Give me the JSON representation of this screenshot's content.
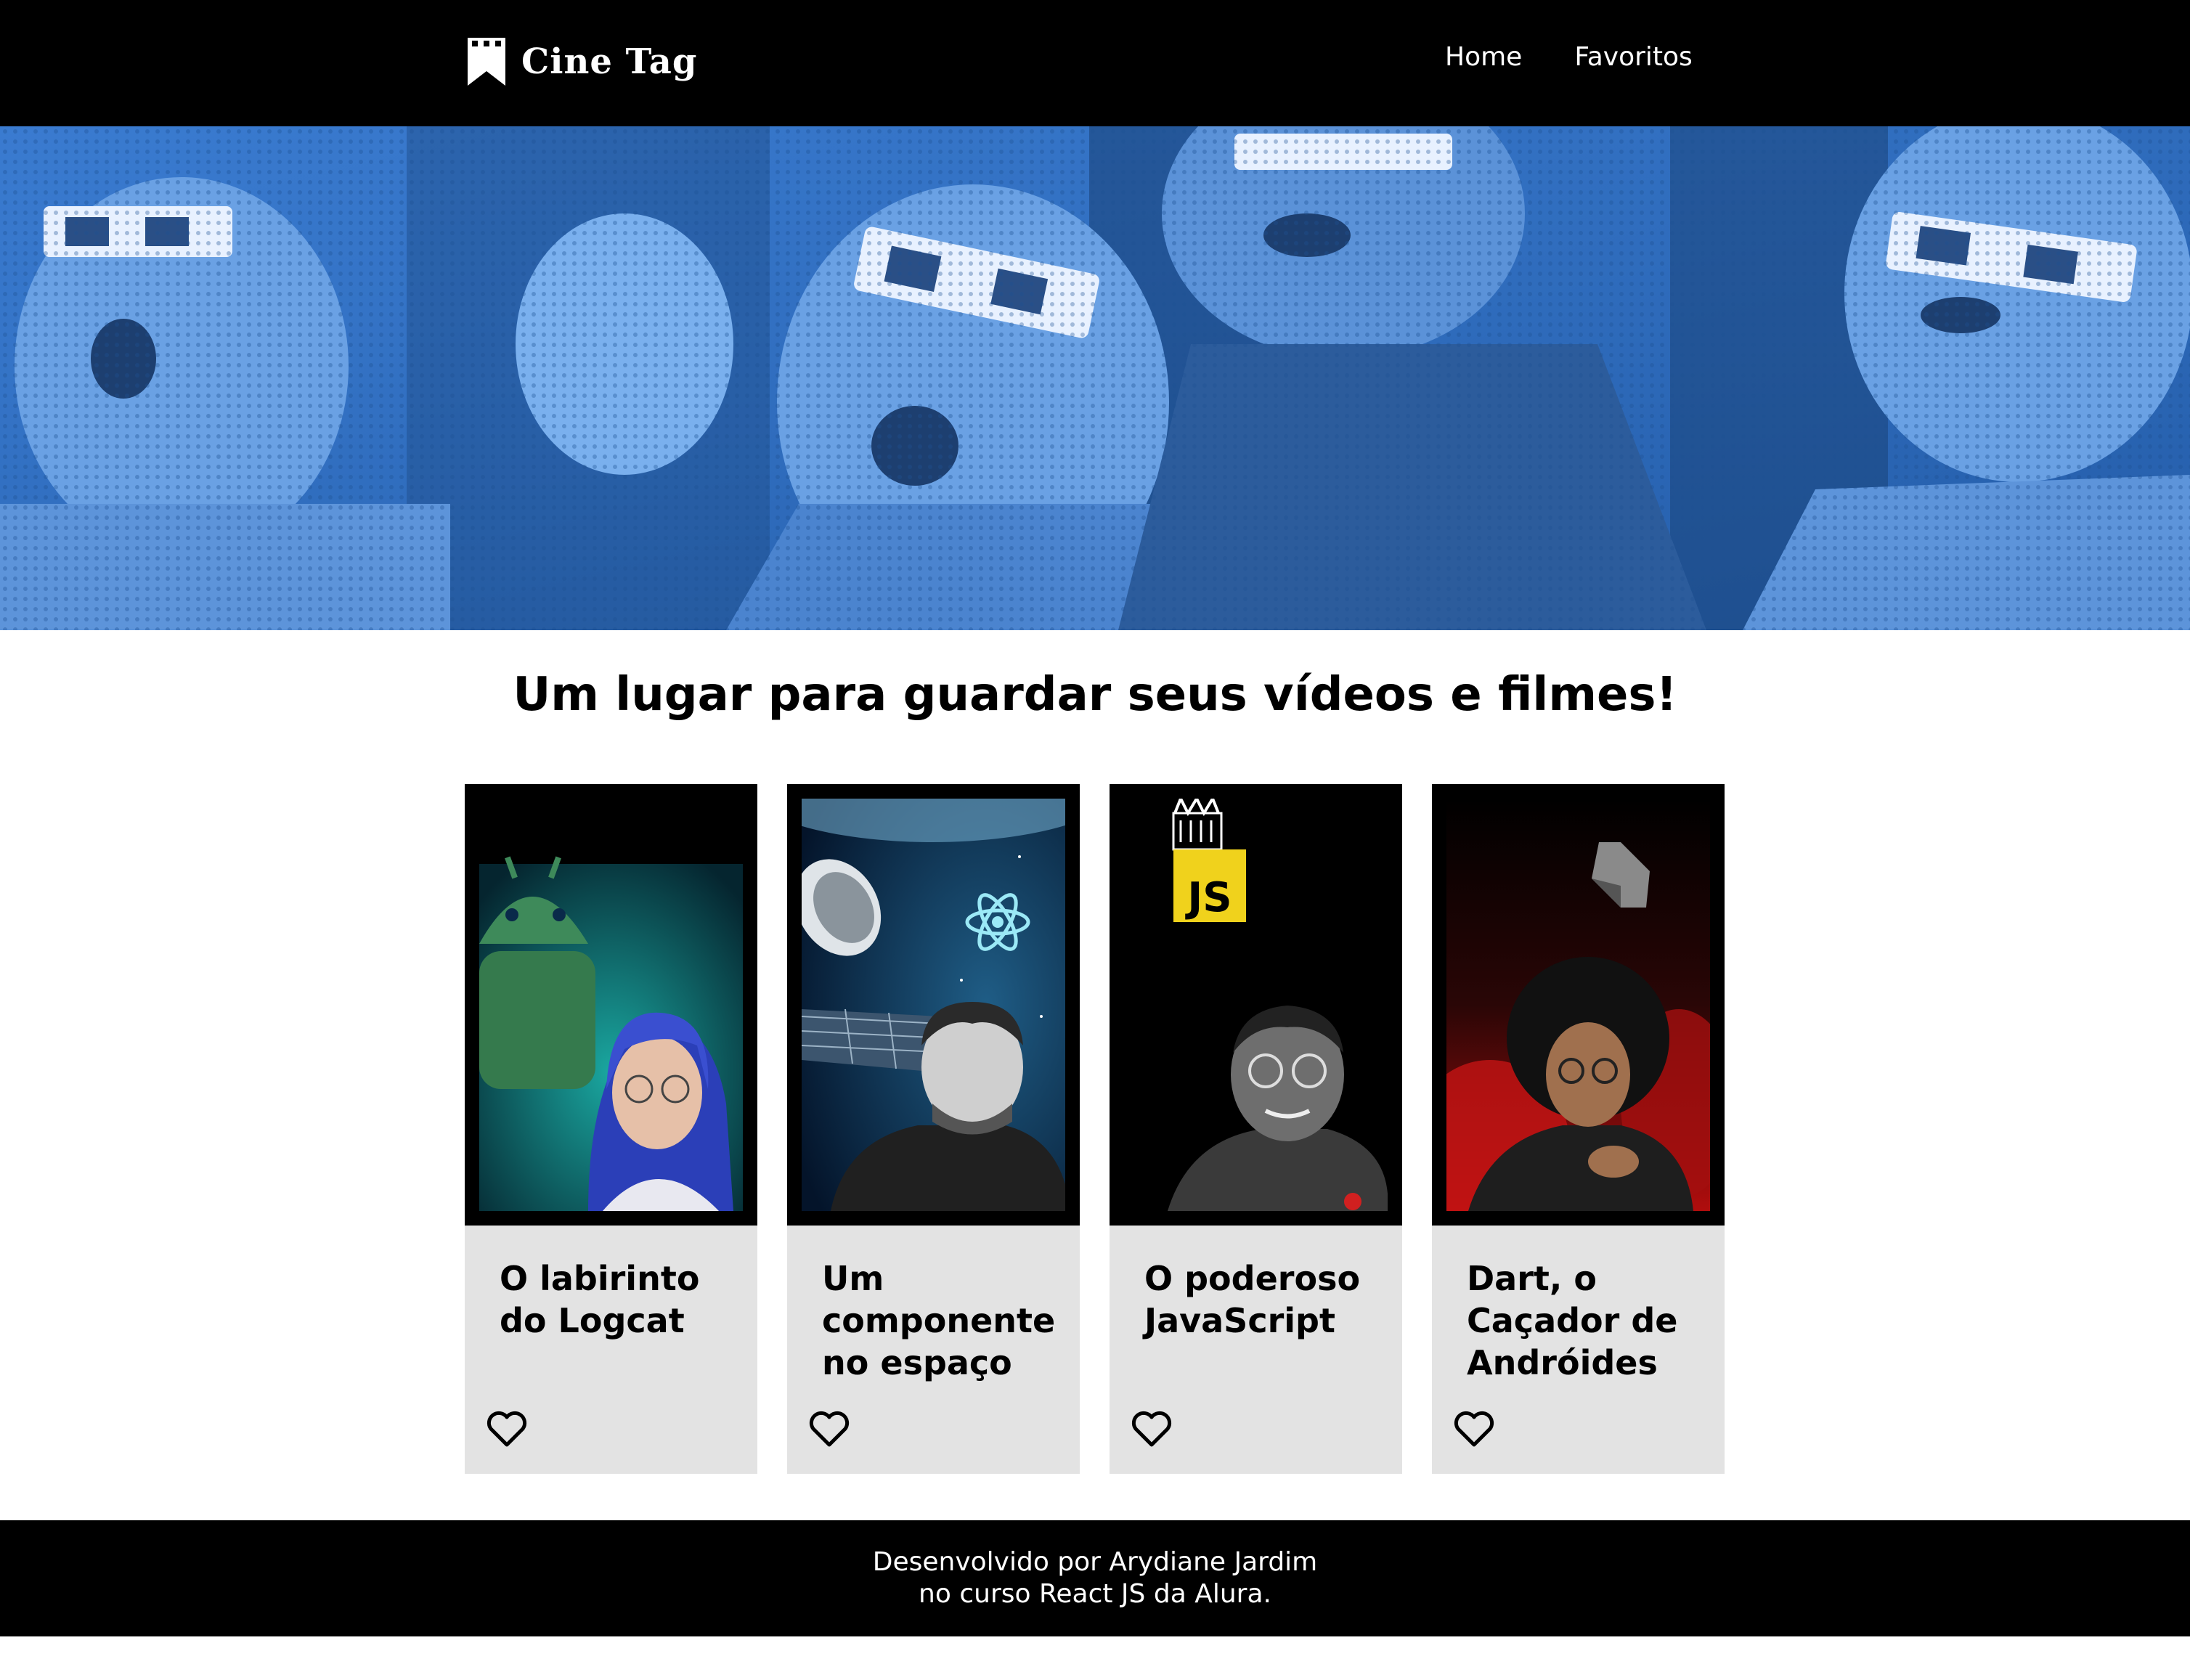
{
  "header": {
    "logo_icon": "bookmark-film-icon",
    "logo_text": "Cine Tag",
    "nav": {
      "home": "Home",
      "favorites": "Favoritos"
    }
  },
  "banner": {
    "description_icon": "cinema-audience-3d-glasses-image",
    "tint": "#2f6fc4"
  },
  "main": {
    "title": "Um lugar para guardar seus vídeos e filmes!"
  },
  "cards": [
    {
      "title": "O labirinto do Logcat",
      "cover_icon": "android-logcat-cover",
      "favorite_icon": "heart-outline-icon"
    },
    {
      "title": "Um componente no espaço",
      "cover_icon": "react-space-cover",
      "favorite_icon": "heart-outline-icon"
    },
    {
      "title": "O poderoso JavaScript",
      "cover_icon": "javascript-cover",
      "cover_badge": "JS",
      "favorite_icon": "heart-outline-icon"
    },
    {
      "title": "Dart, o Caçador de Andróides",
      "cover_icon": "dart-cover",
      "favorite_icon": "heart-outline-icon"
    }
  ],
  "footer": {
    "line1": "Desenvolvido por Arydiane Jardim",
    "line2": "no curso React JS da Alura."
  },
  "colors": {
    "header_bg": "#000000",
    "card_bg": "#e3e3e3",
    "banner_blue": "#2f6fc4",
    "js_yellow": "#f0d21c"
  }
}
